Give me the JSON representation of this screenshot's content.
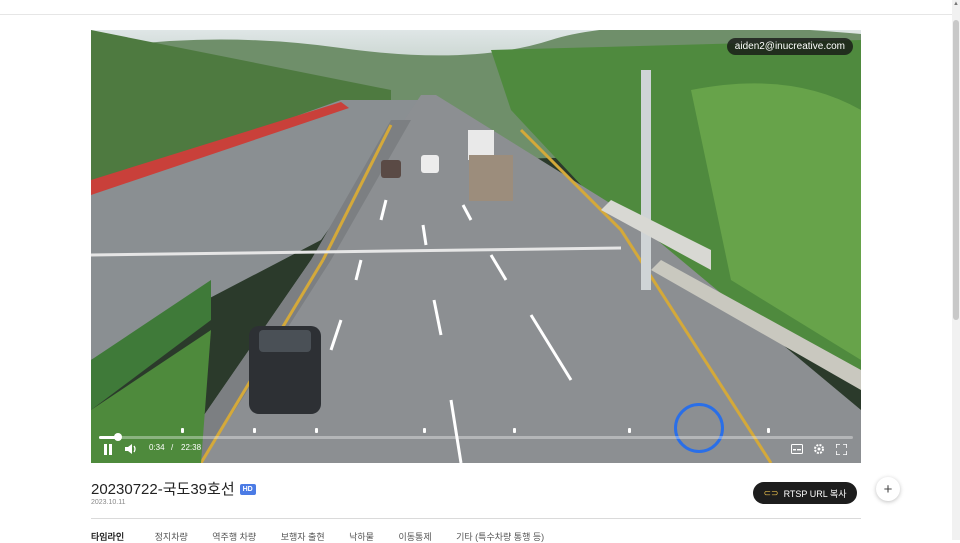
{
  "player": {
    "watermark": "aiden2@inucreative.com",
    "current_time": "0:34",
    "separator": "/",
    "duration": "22:38",
    "progress": 0.025
  },
  "video": {
    "title": "20230722-국도39호선",
    "badge": "HD",
    "date": "2023.10.11"
  },
  "actions": {
    "rtsp_label": "RTSP URL 복사",
    "add_label": "+"
  },
  "tabs": {
    "label": "타임라인",
    "items": [
      "정지차량",
      "역주행 차량",
      "보행자 출현",
      "낙하물",
      "이동통제",
      "기타 (특수차량 통행 등)"
    ]
  }
}
